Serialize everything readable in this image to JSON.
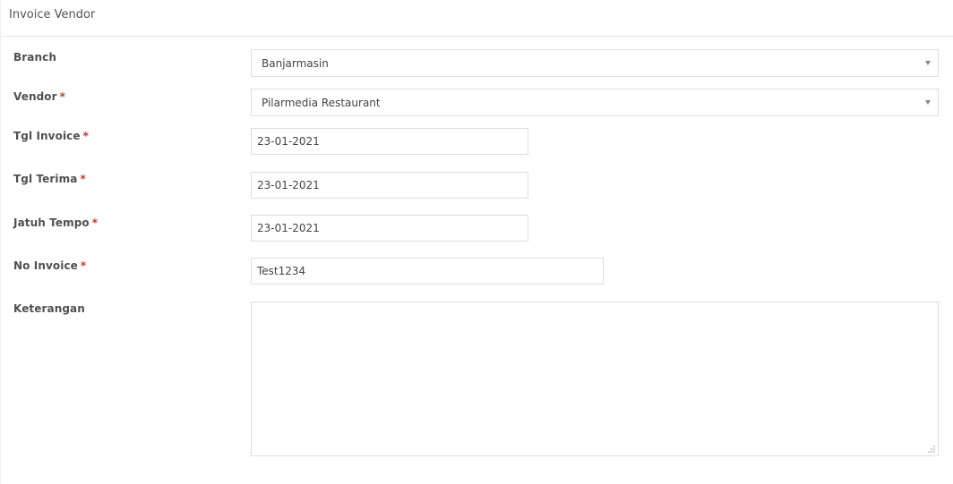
{
  "header": {
    "title": "Invoice Vendor"
  },
  "form": {
    "branch": {
      "label": "Branch",
      "value": "Banjarmasin"
    },
    "vendor": {
      "label": "Vendor",
      "required_mark": "*",
      "value": "Pilarmedia Restaurant"
    },
    "tgl_invoice": {
      "label": "Tgl Invoice",
      "required_mark": "*",
      "value": "23-01-2021"
    },
    "tgl_terima": {
      "label": "Tgl Terima",
      "required_mark": "*",
      "value": "23-01-2021"
    },
    "jatuh_tempo": {
      "label": "Jatuh Tempo",
      "required_mark": "*",
      "value": "23-01-2021"
    },
    "no_invoice": {
      "label": "No Invoice",
      "required_mark": "*",
      "value": "Test1234"
    },
    "keterangan": {
      "label": "Keterangan",
      "value": ""
    }
  },
  "colors": {
    "required": "#c0392b",
    "border": "#dedede",
    "text": "#555555"
  },
  "icons": {
    "select_caret": "chevron-down-icon",
    "resize": "resize-grip-icon"
  }
}
